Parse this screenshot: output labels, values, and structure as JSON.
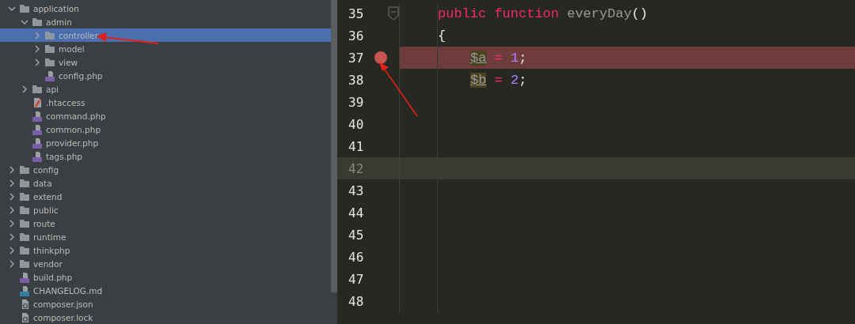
{
  "project_tree": [
    {
      "label": "application",
      "kind": "folder",
      "expanded": true,
      "selected": false,
      "children": [
        {
          "label": "admin",
          "kind": "folder",
          "expanded": true,
          "selected": false,
          "children": [
            {
              "label": "controller",
              "kind": "folder",
              "expanded": false,
              "selected": true
            },
            {
              "label": "model",
              "kind": "folder",
              "expanded": false,
              "selected": false
            },
            {
              "label": "view",
              "kind": "folder",
              "expanded": false,
              "selected": false
            },
            {
              "label": "config.php",
              "kind": "php",
              "selected": false
            }
          ]
        },
        {
          "label": "api",
          "kind": "folder",
          "expanded": false,
          "selected": false
        },
        {
          "label": ".htaccess",
          "kind": "config",
          "selected": false
        },
        {
          "label": "command.php",
          "kind": "php",
          "selected": false
        },
        {
          "label": "common.php",
          "kind": "php",
          "selected": false
        },
        {
          "label": "provider.php",
          "kind": "php",
          "selected": false
        },
        {
          "label": "tags.php",
          "kind": "php",
          "selected": false
        }
      ]
    },
    {
      "label": "config",
      "kind": "folder",
      "expanded": false,
      "selected": false
    },
    {
      "label": "data",
      "kind": "folder",
      "expanded": false,
      "selected": false
    },
    {
      "label": "extend",
      "kind": "folder",
      "expanded": false,
      "selected": false
    },
    {
      "label": "public",
      "kind": "folder",
      "expanded": false,
      "selected": false
    },
    {
      "label": "route",
      "kind": "folder",
      "expanded": false,
      "selected": false
    },
    {
      "label": "runtime",
      "kind": "folder",
      "expanded": false,
      "selected": false
    },
    {
      "label": "thinkphp",
      "kind": "folder",
      "expanded": false,
      "selected": false
    },
    {
      "label": "vendor",
      "kind": "folder",
      "expanded": false,
      "selected": false
    },
    {
      "label": "build.php",
      "kind": "php",
      "selected": false
    },
    {
      "label": "CHANGELOG.md",
      "kind": "markdown",
      "selected": false
    },
    {
      "label": "composer.json",
      "kind": "json",
      "selected": false
    },
    {
      "label": "composer.lock",
      "kind": "json",
      "selected": false
    }
  ],
  "editor": {
    "lines": [
      {
        "number": "35",
        "breakpoint": false,
        "current": false,
        "foldable": true,
        "tokens": [
          {
            "text": "public",
            "kind": "keyword"
          },
          {
            "text": "function",
            "kind": "keyword"
          },
          {
            "text": "everyDay",
            "kind": "name"
          },
          {
            "text": "()",
            "kind": "paren"
          }
        ]
      },
      {
        "number": "36",
        "breakpoint": false,
        "current": false,
        "foldable": false,
        "tokens": [
          {
            "text": "{",
            "kind": "plain"
          }
        ],
        "children": [
          {
            "number": "37",
            "breakpoint": true,
            "current": false,
            "foldable": false,
            "tokens": [
              {
                "text": "$a",
                "kind": "variable"
              },
              {
                "text": "=",
                "kind": "operator"
              },
              {
                "text": "1",
                "kind": "number"
              },
              {
                "text": ";",
                "kind": "punct"
              }
            ]
          },
          {
            "number": "38",
            "breakpoint": false,
            "current": false,
            "foldable": false,
            "tokens": [
              {
                "text": "$b",
                "kind": "variable"
              },
              {
                "text": "=",
                "kind": "operator"
              },
              {
                "text": "2",
                "kind": "number"
              },
              {
                "text": ";",
                "kind": "punct"
              }
            ]
          }
        ]
      },
      {
        "number": "39",
        "breakpoint": false,
        "current": false,
        "foldable": false
      },
      {
        "number": "40",
        "breakpoint": false,
        "current": false,
        "foldable": false
      },
      {
        "number": "41",
        "breakpoint": false,
        "current": false,
        "foldable": false
      },
      {
        "number": "42",
        "breakpoint": false,
        "current": true,
        "foldable": false
      },
      {
        "number": "43",
        "breakpoint": false,
        "current": false,
        "foldable": false
      },
      {
        "number": "44",
        "breakpoint": false,
        "current": false,
        "foldable": false
      },
      {
        "number": "45",
        "breakpoint": false,
        "current": false,
        "foldable": false
      },
      {
        "number": "46",
        "breakpoint": false,
        "current": false,
        "foldable": false
      },
      {
        "number": "47",
        "breakpoint": false,
        "current": false,
        "foldable": false
      },
      {
        "number": "48",
        "breakpoint": false,
        "current": false,
        "foldable": false
      }
    ]
  }
}
